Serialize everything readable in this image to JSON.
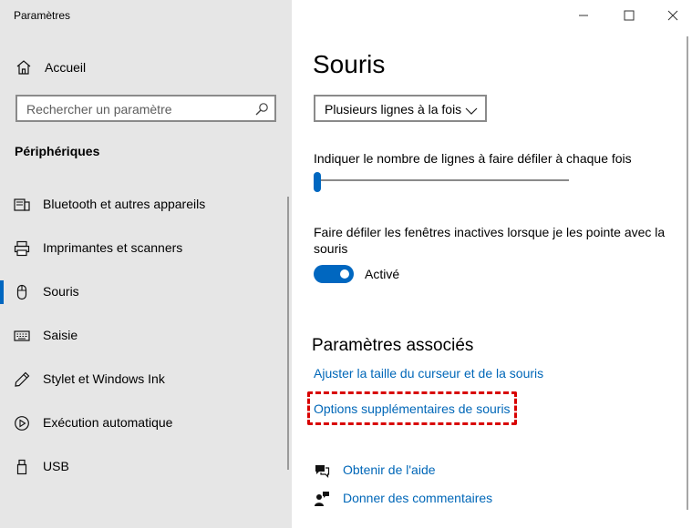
{
  "window": {
    "title": "Paramètres",
    "controls": [
      "minimize",
      "maximize",
      "close"
    ]
  },
  "sidebar": {
    "home_label": "Accueil",
    "search_placeholder": "Rechercher un paramètre",
    "section_title": "Périphériques",
    "items": [
      {
        "label": "Bluetooth et autres appareils",
        "icon": "bluetooth-devices-icon"
      },
      {
        "label": "Imprimantes et scanners",
        "icon": "printer-icon"
      },
      {
        "label": "Souris",
        "icon": "mouse-icon",
        "selected": true
      },
      {
        "label": "Saisie",
        "icon": "keyboard-icon"
      },
      {
        "label": "Stylet et Windows Ink",
        "icon": "pen-icon"
      },
      {
        "label": "Exécution automatique",
        "icon": "autoplay-icon"
      },
      {
        "label": "USB",
        "icon": "usb-icon"
      }
    ]
  },
  "main": {
    "title": "Souris",
    "scroll_dropdown_value": "Plusieurs lignes à la fois",
    "lines_label": "Indiquer le nombre de lignes à faire défiler à chaque fois",
    "lines_slider_fraction": 0.0,
    "inactive_scroll_label": "Faire défiler les fenêtres inactives lorsque je les pointe avec la souris",
    "inactive_scroll_state": "Activé",
    "inactive_scroll_on": true,
    "related_title": "Paramètres associés",
    "related_links": [
      "Ajuster la taille du curseur et de la souris",
      "Options supplémentaires de souris"
    ],
    "help": {
      "get_help": "Obtenir de l'aide",
      "feedback": "Donner des commentaires"
    }
  },
  "colors": {
    "accent": "#0067c0",
    "link": "#0067b8",
    "highlight": "#d80000",
    "sidebar_bg": "#e6e6e6"
  }
}
